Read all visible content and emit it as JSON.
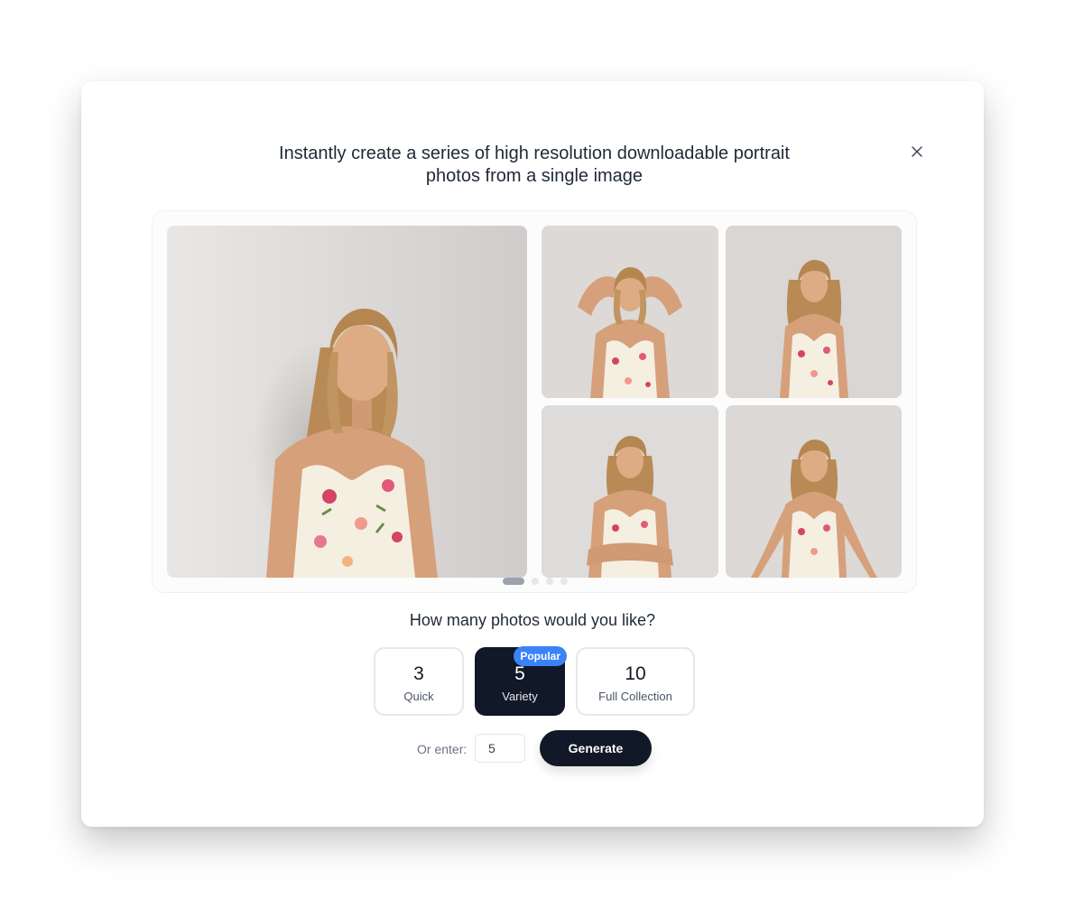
{
  "dialog": {
    "title_line1": "Instantly create a series of high resolution downloadable portrait",
    "title_line2": "photos from a single image",
    "close_icon": "close-icon"
  },
  "gallery": {
    "photos": [
      {
        "pose": "main-portrait"
      },
      {
        "pose": "hands-in-hair"
      },
      {
        "pose": "standing-front"
      },
      {
        "pose": "arms-crossed"
      },
      {
        "pose": "arms-down"
      }
    ],
    "carousel": {
      "total_pages": 4,
      "current_page": 1
    }
  },
  "question": "How many photos would you like?",
  "options": [
    {
      "value": "3",
      "label": "Quick",
      "selected": false,
      "badge": ""
    },
    {
      "value": "5",
      "label": "Variety",
      "selected": true,
      "badge": "Popular"
    },
    {
      "value": "10",
      "label": "Full Collection",
      "selected": false,
      "badge": ""
    }
  ],
  "custom": {
    "label": "Or enter:",
    "value": "5"
  },
  "generate_label": "Generate",
  "colors": {
    "primary_dark": "#111827",
    "badge_blue": "#3b82f6",
    "border": "#e5e7eb"
  }
}
